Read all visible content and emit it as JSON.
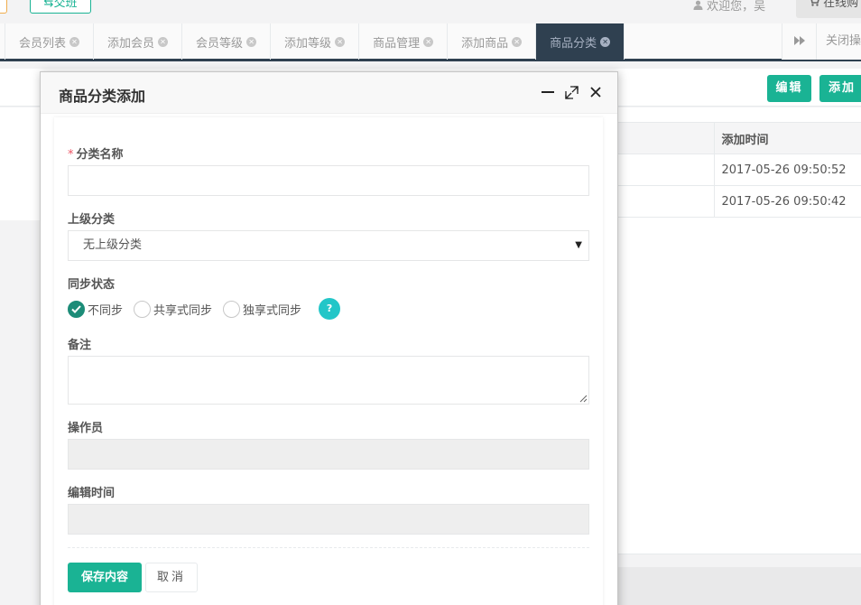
{
  "header": {
    "shift_label": "⇆交班",
    "welcome_text": "欢迎您，吴",
    "online_label": "在线购"
  },
  "tabs": [
    {
      "label": "会员列表",
      "active": false
    },
    {
      "label": "添加会员",
      "active": false
    },
    {
      "label": "会员等级",
      "active": false
    },
    {
      "label": "添加等级",
      "active": false
    },
    {
      "label": "商品管理",
      "active": false
    },
    {
      "label": "添加商品",
      "active": false
    },
    {
      "label": "商品分类",
      "active": true
    }
  ],
  "tabbar": {
    "close_ops_label": "关闭操"
  },
  "toolbar": {
    "edit_label": "编辑",
    "add_label": "添加"
  },
  "table": {
    "header": "添加时间",
    "rows": [
      {
        "time": "2017-05-26 09:50:52"
      },
      {
        "time": "2017-05-26 09:50:42"
      }
    ]
  },
  "modal": {
    "title": "商品分类添加",
    "fields": {
      "name_label": "分类名称",
      "name_value": "",
      "parent_label": "上级分类",
      "parent_value": "无上级分类",
      "sync_label": "同步状态",
      "sync_options": [
        {
          "label": "不同步",
          "checked": true
        },
        {
          "label": "共享式同步",
          "checked": false
        },
        {
          "label": "独享式同步",
          "checked": false
        }
      ],
      "remark_label": "备注",
      "operator_label": "操作员",
      "operator_value": "",
      "edit_time_label": "编辑时间",
      "edit_time_value": ""
    },
    "save_label": "保存内容",
    "cancel_label": "取消"
  },
  "colors": {
    "primary": "#1ab394",
    "nav_dark": "#2f4050",
    "info": "#23c6c8",
    "radio_checked": "#1c8c78",
    "required": "#ed5565"
  }
}
